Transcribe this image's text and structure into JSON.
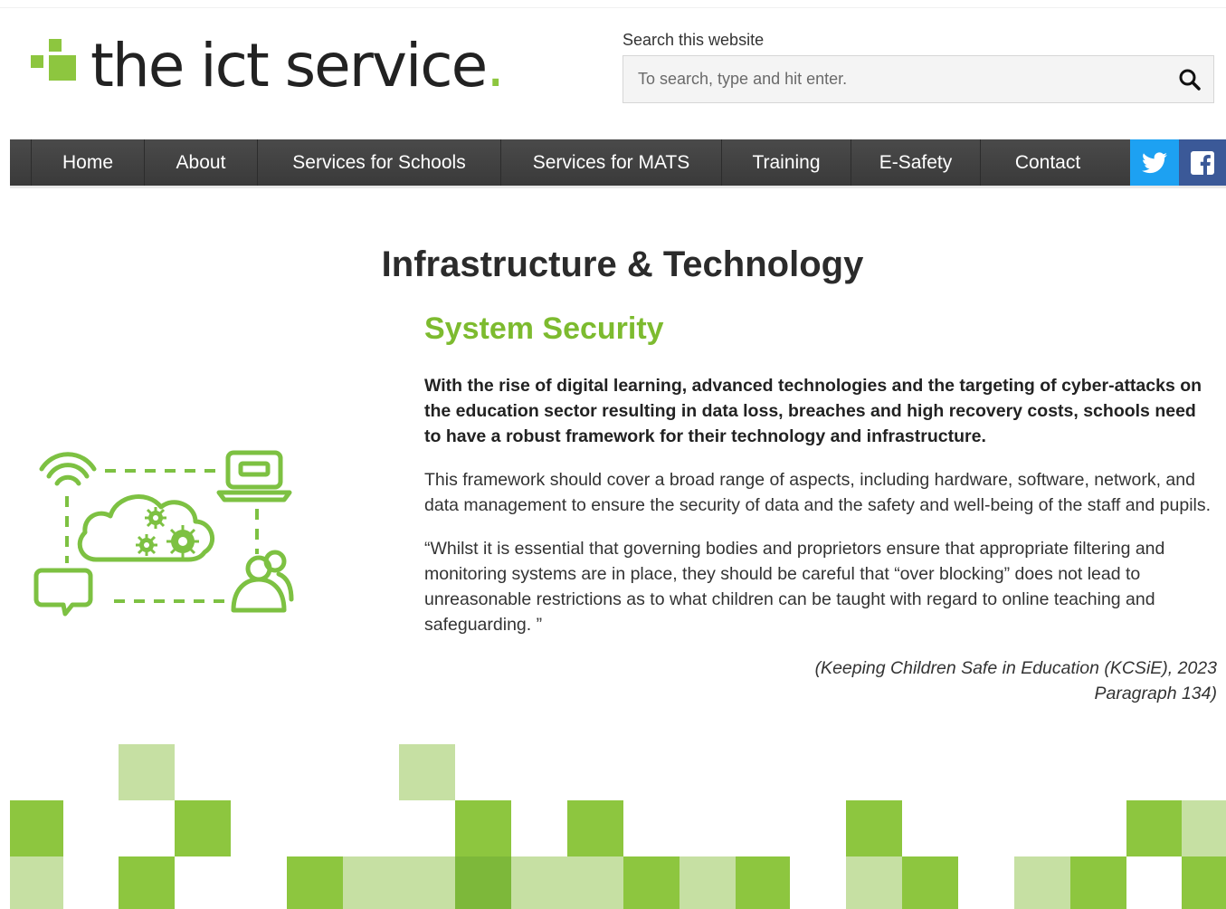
{
  "header": {
    "logo_text": "the ict service",
    "logo_dot": ".",
    "search": {
      "label": "Search this website",
      "placeholder": "To search, type and hit enter."
    }
  },
  "nav": {
    "items": [
      {
        "label": "Home"
      },
      {
        "label": "About"
      },
      {
        "label": "Services for Schools"
      },
      {
        "label": "Services for MATS"
      },
      {
        "label": "Training"
      },
      {
        "label": "E-Safety"
      },
      {
        "label": "Contact"
      }
    ],
    "social": [
      "twitter-icon",
      "facebook-icon"
    ]
  },
  "main": {
    "page_title": "Infrastructure & Technology",
    "section_title": "System Security",
    "intro": "With the rise of digital learning, advanced technologies and the targeting of cyber-attacks on the education sector resulting in data loss, breaches and high recovery costs, schools need to have a robust framework for their technology and infrastructure.",
    "paragraph": "This framework should cover a broad range of aspects, including hardware, software, network, and data management to ensure the security of data and the safety and well-being of the staff and pupils.",
    "quote": "“Whilst it is essential that governing bodies and proprietors ensure that appropriate filtering and monitoring systems are in place, they should be careful that “over blocking” does not lead to unreasonable restrictions as to what children can be taught with regard to online teaching and safeguarding. ”",
    "citation_line1": "(Keeping Children Safe in Education (KCSiE), 2023",
    "citation_line2": "Paragraph 134)"
  },
  "colors": {
    "brand_green": "#8dc63f",
    "light_green": "#c6e0a3",
    "dark_green": "#7db83a",
    "nav_bg": "#424242",
    "twitter": "#1da1f2",
    "facebook": "#3b5998"
  }
}
